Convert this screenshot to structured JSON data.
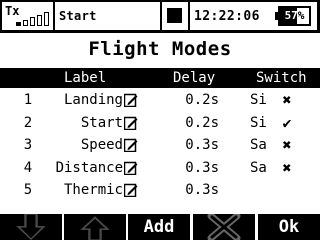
{
  "status": {
    "tx_label": "Tx",
    "signal_bars_lit": 1,
    "signal_bars_total": 5,
    "model_name": "Start",
    "time": "12:22:06",
    "battery_text": "57%",
    "battery_level": 0.57
  },
  "page": {
    "title": "Flight Modes"
  },
  "table": {
    "headers": {
      "label": "Label",
      "delay": "Delay",
      "switch": "Switch"
    },
    "rows": [
      {
        "index": "1",
        "label": "Landing",
        "delay": "0.2s",
        "switch": "Si",
        "state": "✖"
      },
      {
        "index": "2",
        "label": "Start",
        "delay": "0.2s",
        "switch": "Si",
        "state": "✔"
      },
      {
        "index": "3",
        "label": "Speed",
        "delay": "0.3s",
        "switch": "Sa",
        "state": "✖"
      },
      {
        "index": "4",
        "label": "Distance",
        "delay": "0.3s",
        "switch": "Sa",
        "state": "✖"
      },
      {
        "index": "5",
        "label": "Thermic",
        "delay": "0.3s",
        "switch": "",
        "state": ""
      }
    ]
  },
  "buttons": {
    "down_icon": "arrow-down-icon",
    "up_icon": "arrow-up-icon",
    "add": "Add",
    "delete_icon": "delete-x-icon",
    "ok": "Ok"
  }
}
